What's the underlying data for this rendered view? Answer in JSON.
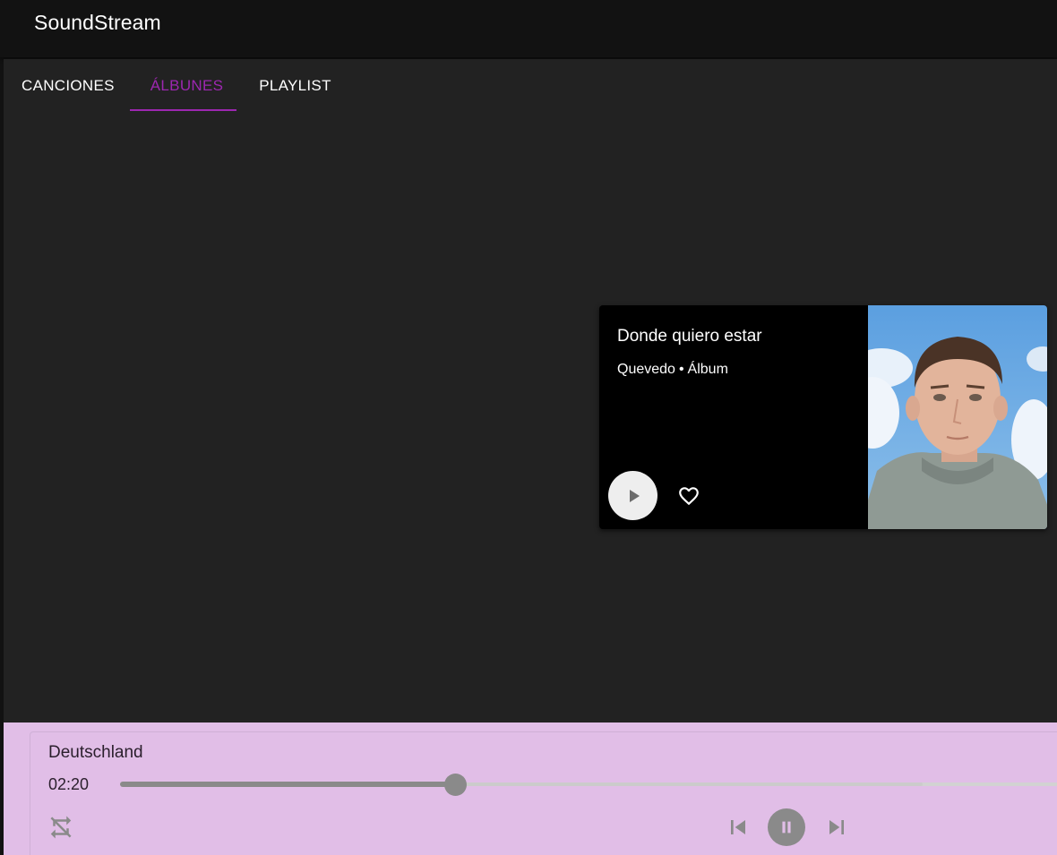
{
  "app": {
    "title": "SoundStream"
  },
  "tabs": [
    {
      "label": "CANCIONES",
      "active": false
    },
    {
      "label": "ÁLBUNES",
      "active": true
    },
    {
      "label": "PLAYLIST",
      "active": false
    }
  ],
  "album_card": {
    "title": "Donde quiero estar",
    "artist": "Quevedo",
    "separator": "•",
    "type": "Álbum",
    "play_icon": "play-arrow-icon",
    "like_icon": "heart-outline-icon"
  },
  "player": {
    "track": "Deutschland",
    "elapsed": "02:20",
    "progress_percent": 35.3,
    "buffered_percent": 84.5,
    "icons": {
      "repeat": "repeat-off-icon",
      "previous": "skip-previous-icon",
      "pause": "pause-icon",
      "next": "skip-next-icon"
    }
  },
  "colors": {
    "accent": "#9c27b0",
    "player_background": "#e1bee7",
    "panel_background": "#222222",
    "appbar_background": "#121212",
    "control_gray": "#8a8a8a"
  }
}
